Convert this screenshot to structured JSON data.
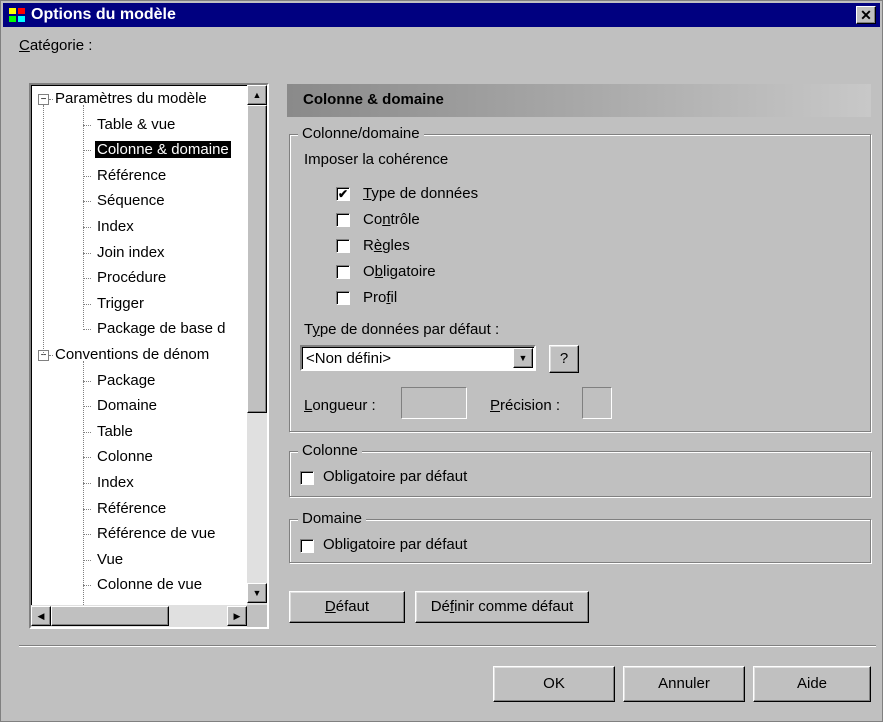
{
  "window": {
    "title": "Options du modèle",
    "close_glyph": "✕"
  },
  "category": {
    "label_mnemonic": "C",
    "label_rest": "atégorie :"
  },
  "tree": {
    "items": [
      {
        "label": "Paramètres du modèle",
        "level": 0,
        "expander": "−"
      },
      {
        "label": "Table & vue",
        "level": 1
      },
      {
        "label": "Colonne & domaine",
        "level": 1,
        "selected": true
      },
      {
        "label": "Référence",
        "level": 1
      },
      {
        "label": "Séquence",
        "level": 1
      },
      {
        "label": "Index",
        "level": 1
      },
      {
        "label": "Join index",
        "level": 1
      },
      {
        "label": "Procédure",
        "level": 1
      },
      {
        "label": "Trigger",
        "level": 1
      },
      {
        "label": "Package de base d",
        "level": 1
      },
      {
        "label": "Conventions de dénom",
        "level": 0,
        "expander": "−"
      },
      {
        "label": "Package",
        "level": 1
      },
      {
        "label": "Domaine",
        "level": 1
      },
      {
        "label": "Table",
        "level": 1
      },
      {
        "label": "Colonne",
        "level": 1
      },
      {
        "label": "Index",
        "level": 1
      },
      {
        "label": "Référence",
        "level": 1
      },
      {
        "label": "Référence de vue",
        "level": 1
      },
      {
        "label": "Vue",
        "level": 1
      },
      {
        "label": "Colonne de vue",
        "level": 1
      }
    ],
    "scroll_up": "▲",
    "scroll_down": "▼",
    "scroll_left": "◀",
    "scroll_right": "▶"
  },
  "panel": {
    "header": "Colonne & domaine",
    "group_coldom": {
      "title": "Colonne/domaine",
      "impose_label": "Imposer la cohérence",
      "checks": [
        {
          "m": "T",
          "rest": "ype de données",
          "pre": "",
          "checked": true
        },
        {
          "pre": "Co",
          "m": "n",
          "rest": "trôle",
          "checked": false
        },
        {
          "pre": "R",
          "m": "è",
          "rest": "gles",
          "checked": false
        },
        {
          "pre": "O",
          "m": "b",
          "rest": "ligatoire",
          "checked": false
        },
        {
          "pre": "Pro",
          "m": "f",
          "rest": "il",
          "checked": false
        }
      ],
      "default_type_pre": "T",
      "default_type_m": "y",
      "default_type_rest": "pe de données par défaut :",
      "default_type_value": "<Non défini>",
      "combo_arrow": "▼",
      "help_button": "?",
      "length_m": "L",
      "length_rest": "ongueur :",
      "precision_m": "P",
      "precision_rest": "récision :",
      "check_glyph": "✔"
    },
    "group_colonne": {
      "title": "Colonne",
      "check_label": "Obligatoire par défaut",
      "checked": false
    },
    "group_domaine": {
      "title": "Domaine",
      "check_label": "Obligatoire par défaut",
      "checked": false
    },
    "default_button_m": "D",
    "default_button_rest": "éfaut",
    "set_default_pre": "Dé",
    "set_default_m": "f",
    "set_default_rest": "inir comme défaut"
  },
  "footer": {
    "ok": "OK",
    "cancel": "Annuler",
    "help": "Aide"
  }
}
